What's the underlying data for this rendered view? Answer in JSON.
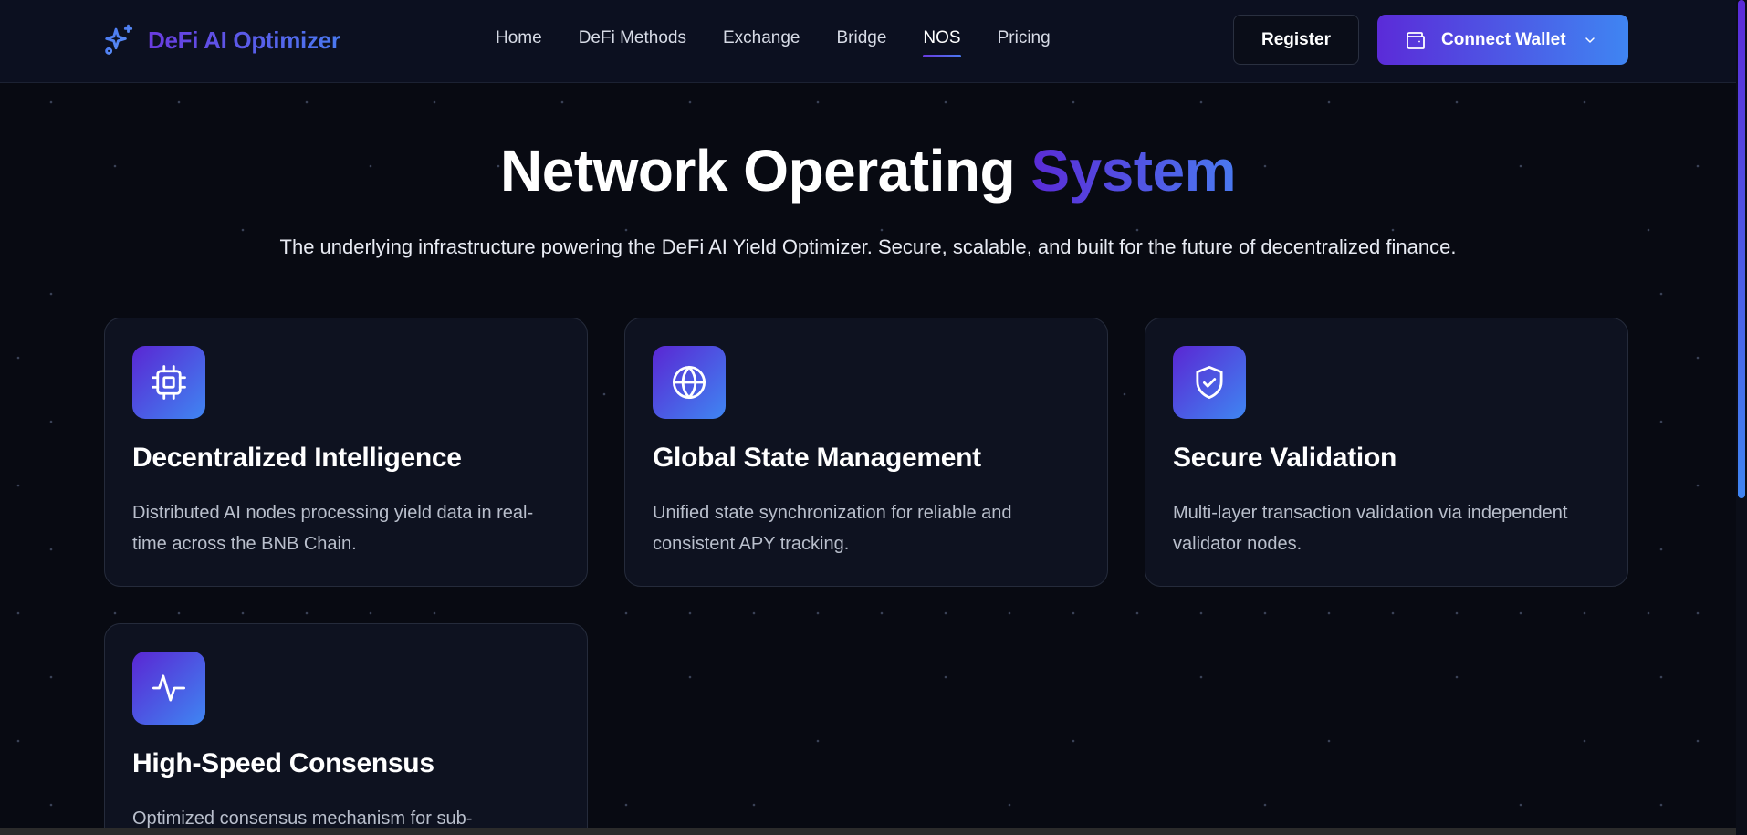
{
  "header": {
    "brand": "DeFi AI Optimizer",
    "nav": [
      {
        "label": "Home",
        "active": false
      },
      {
        "label": "DeFi Methods",
        "active": false
      },
      {
        "label": "Exchange",
        "active": false
      },
      {
        "label": "Bridge",
        "active": false
      },
      {
        "label": "NOS",
        "active": true
      },
      {
        "label": "Pricing",
        "active": false
      }
    ],
    "register_label": "Register",
    "connect_wallet_label": "Connect Wallet"
  },
  "hero": {
    "title_main": "Network Operating ",
    "title_accent": "System",
    "subtitle": "The underlying infrastructure powering the DeFi AI Yield Optimizer. Secure, scalable, and built for the future of decentralized finance."
  },
  "features": [
    {
      "icon": "cpu-icon",
      "title": "Decentralized Intelligence",
      "description": "Distributed AI nodes processing yield data in real-time across the BNB Chain."
    },
    {
      "icon": "globe-icon",
      "title": "Global State Management",
      "description": "Unified state synchronization for reliable and consistent APY tracking."
    },
    {
      "icon": "shield-check-icon",
      "title": "Secure Validation",
      "description": "Multi-layer transaction validation via independent validator nodes."
    },
    {
      "icon": "activity-icon",
      "title": "High-Speed Consensus",
      "description": "Optimized consensus mechanism for sub-"
    }
  ],
  "colors": {
    "background": "#080a12",
    "header": "#0c1020",
    "card": "#0e1220",
    "accent_start": "#5a26d3",
    "accent_end": "#3f86f2"
  }
}
